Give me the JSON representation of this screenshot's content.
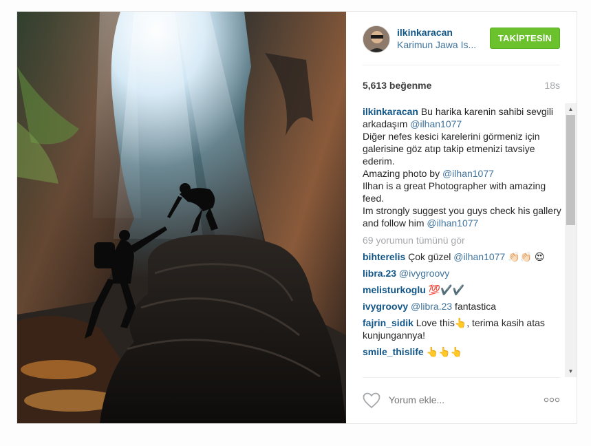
{
  "post": {
    "username": "ilkinkaracan",
    "location": "Karimun Jawa Is...",
    "follow_label": "TAKİPTESİN",
    "likes": "5,613 beğenme",
    "time": "18s"
  },
  "caption": {
    "user": "ilkinkaracan",
    "t1": " Bu harika karenin sahibi sevgili arkadaşım ",
    "m1": "@ilhan1077",
    "t2": "Diğer nefes kesici karelerini görmeniz için galerisine göz atıp takip etmenizi tavsiye ederim.",
    "t3": "Amazing photo by ",
    "m2": "@ilhan1077",
    "t4": "Ilhan is a great Photographer with amazing feed.",
    "t5": "Im strongly suggest you guys check his gallery and follow him ",
    "m3": "@ilhan1077"
  },
  "view_all": "69 yorumun tümünü gör",
  "comments": [
    {
      "user": "bihterelis",
      "t1": " Çok güzel ",
      "mention": "@ilhan1077",
      "t2": " 👏🏻👏🏻 😍"
    },
    {
      "user": "libra.23",
      "t1": " ",
      "mention": "@ivygroovy",
      "t2": ""
    },
    {
      "user": "melisturkoglu",
      "t1": " 💯✔️✔️",
      "mention": "",
      "t2": ""
    },
    {
      "user": "ivygroovy",
      "t1": " ",
      "mention": "@libra.23",
      "t2": " fantastica"
    },
    {
      "user": "fajrin_sidik",
      "t1": " Love this👆, terima kasih atas kunjungannya!",
      "mention": "",
      "t2": ""
    },
    {
      "user": "smile_thislife",
      "t1": " 👆👆👆",
      "mention": "",
      "t2": ""
    }
  ],
  "comment_placeholder": "Yorum ekle...",
  "icons": {
    "heart": "heart-icon",
    "more": "more-options-icon",
    "scroll_up": "scroll-up-arrow-icon",
    "scroll_down": "scroll-down-arrow-icon"
  },
  "colors": {
    "link": "#125688",
    "mention": "#3f729b",
    "follow": "#6bc22c",
    "muted": "#a5a7aa"
  }
}
